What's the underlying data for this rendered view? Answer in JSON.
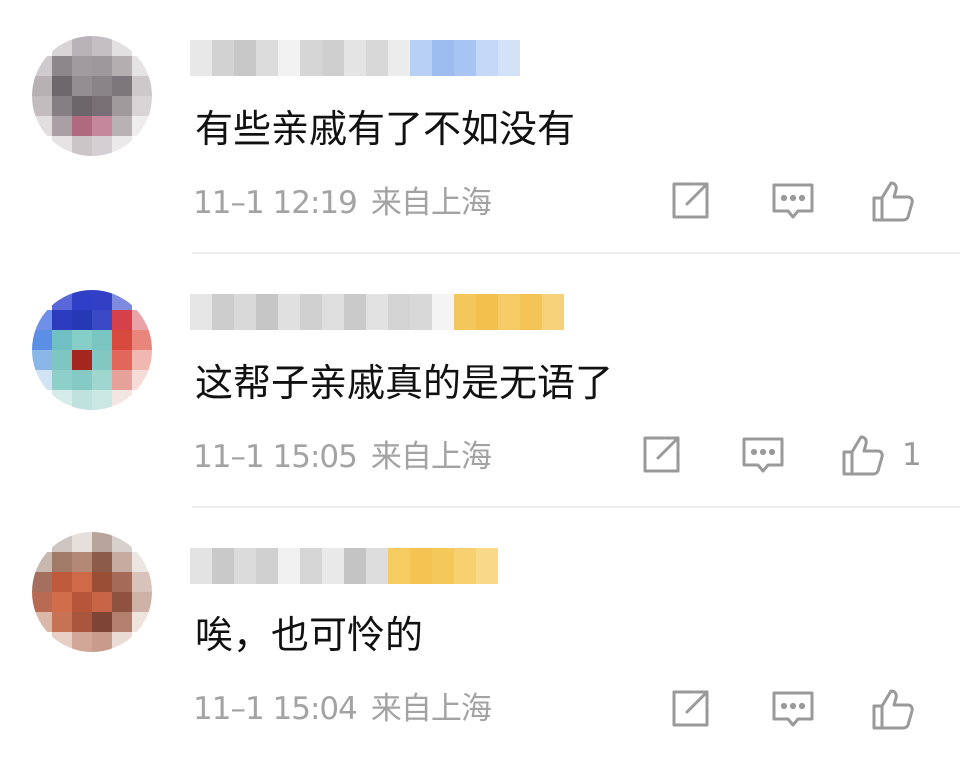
{
  "comments": [
    {
      "text": "有些亲戚有了不如没有",
      "time": "11–1 12:19",
      "location": "来自上海",
      "like_count": ""
    },
    {
      "text": "这帮子亲戚真的是无语了",
      "time": "11–1 15:05",
      "location": "来自上海",
      "like_count": "1"
    },
    {
      "text": "唉，也可怜的",
      "time": "11–1 15:04",
      "location": "来自上海",
      "like_count": ""
    }
  ],
  "icons": {
    "share": "share-icon",
    "reply": "comment-icon",
    "like": "thumbs-up-icon"
  },
  "colors": {
    "meta_text": "#a3a3a3",
    "icon_stroke": "#9a9a9a",
    "divider": "#eeeeee",
    "badge_blue": "#8fb6f2",
    "badge_gold": "#f2c14e"
  }
}
